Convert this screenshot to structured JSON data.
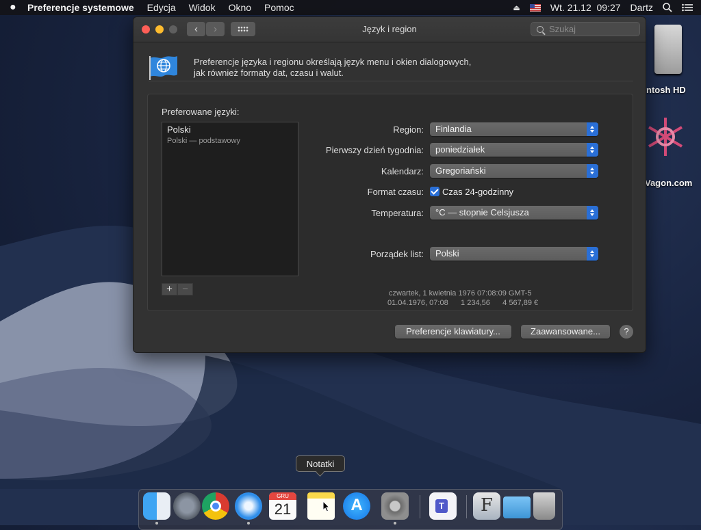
{
  "menubar": {
    "apple": "",
    "items": [
      "Preferencje systemowe",
      "Edycja",
      "Widok",
      "Okno",
      "Pomoc"
    ],
    "clock": "Wt. 21.12  09:27",
    "user": "Dartz"
  },
  "desktop": {
    "hd_label": "ntosh HD",
    "wagon_label": "Vagon.com"
  },
  "window": {
    "title": "Język i region",
    "search_placeholder": "Szukaj",
    "description_line1": "Preferencje języka i regionu określają język menu i okien dialogowych,",
    "description_line2": "jak również formaty dat, czasu i walut.",
    "preferred_label": "Preferowane języki:",
    "languages": [
      {
        "name": "Polski",
        "sub": "Polski — podstawowy"
      }
    ],
    "add": "+",
    "remove": "−",
    "rows": {
      "region_label": "Region:",
      "region_value": "Finlandia",
      "weekday_label": "Pierwszy dzień tygodnia:",
      "weekday_value": "poniedziałek",
      "calendar_label": "Kalendarz:",
      "calendar_value": "Gregoriański",
      "timeformat_label": "Format czasu:",
      "timeformat_value": "Czas 24-godzinny",
      "temperature_label": "Temperatura:",
      "temperature_value": "°C — stopnie Celsjusza",
      "order_label": "Porządek list:",
      "order_value": "Polski"
    },
    "sample_line1": "czwartek, 1 kwietnia 1976 07:08:09 GMT-5",
    "sample_line2": "01.04.1976, 07:08      1 234,56      4 567,89 €",
    "keyboard_button": "Preferencje klawiatury...",
    "advanced_button": "Zaawansowane...",
    "help": "?"
  },
  "dock": {
    "tooltip": "Notatki",
    "calendar_month": "GRU",
    "calendar_day": "21"
  },
  "colors": {
    "accent": "#2a6fd6",
    "window_bg": "#323232"
  }
}
